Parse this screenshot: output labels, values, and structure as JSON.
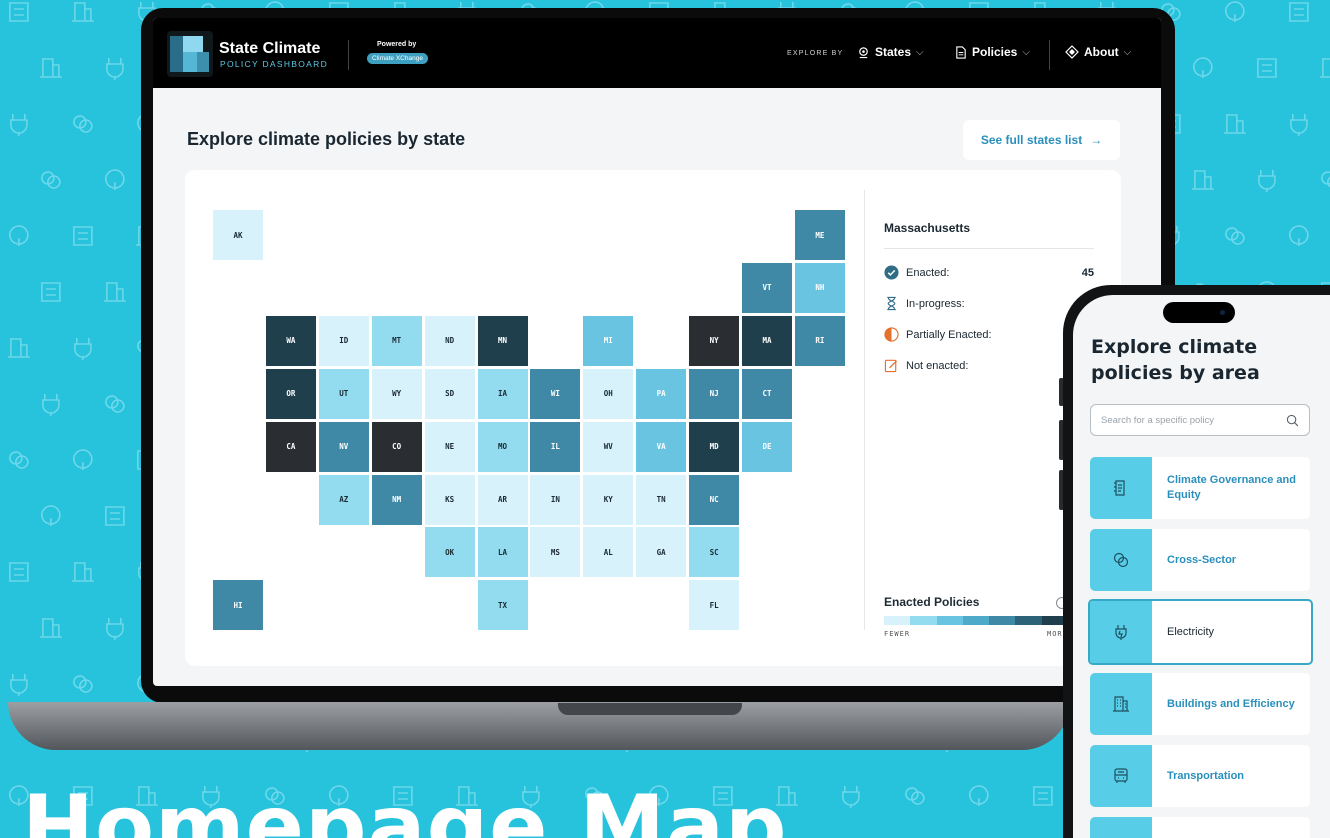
{
  "app": {
    "logo_title": "State Climate",
    "logo_subtitle": "POLICY DASHBOARD",
    "powered_by": "Powered by",
    "partner": "Climate XChange"
  },
  "nav": {
    "explore_by": "EXPLORE BY",
    "states": "States",
    "policies": "Policies",
    "about": "About"
  },
  "page": {
    "title": "Explore climate policies by state",
    "see_all": "See full states list",
    "see_all_arrow": "→"
  },
  "map": {
    "states": [
      {
        "abbr": "AK",
        "shade": 1
      },
      {
        "abbr": "ME",
        "shade": 4
      },
      {
        "abbr": "VT",
        "shade": 4
      },
      {
        "abbr": "NH",
        "shade": 3
      },
      {
        "abbr": "WA",
        "shade": 5
      },
      {
        "abbr": "ID",
        "shade": 1
      },
      {
        "abbr": "MT",
        "shade": 2
      },
      {
        "abbr": "ND",
        "shade": 1
      },
      {
        "abbr": "MN",
        "shade": 5
      },
      {
        "abbr": "MI",
        "shade": 3
      },
      {
        "abbr": "NY",
        "shade": 6
      },
      {
        "abbr": "MA",
        "shade": 5
      },
      {
        "abbr": "RI",
        "shade": 4
      },
      {
        "abbr": "OR",
        "shade": 5
      },
      {
        "abbr": "UT",
        "shade": 2
      },
      {
        "abbr": "WY",
        "shade": 1
      },
      {
        "abbr": "SD",
        "shade": 1
      },
      {
        "abbr": "IA",
        "shade": 2
      },
      {
        "abbr": "WI",
        "shade": 4
      },
      {
        "abbr": "OH",
        "shade": 1
      },
      {
        "abbr": "PA",
        "shade": 3
      },
      {
        "abbr": "NJ",
        "shade": 4
      },
      {
        "abbr": "CT",
        "shade": 4
      },
      {
        "abbr": "CA",
        "shade": 6
      },
      {
        "abbr": "NV",
        "shade": 4
      },
      {
        "abbr": "CO",
        "shade": 6
      },
      {
        "abbr": "NE",
        "shade": 1
      },
      {
        "abbr": "MO",
        "shade": 2
      },
      {
        "abbr": "IL",
        "shade": 4
      },
      {
        "abbr": "WV",
        "shade": 1
      },
      {
        "abbr": "VA",
        "shade": 3
      },
      {
        "abbr": "MD",
        "shade": 5
      },
      {
        "abbr": "DE",
        "shade": 3
      },
      {
        "abbr": "AZ",
        "shade": 2
      },
      {
        "abbr": "NM",
        "shade": 4
      },
      {
        "abbr": "KS",
        "shade": 1
      },
      {
        "abbr": "AR",
        "shade": 1
      },
      {
        "abbr": "IN",
        "shade": 1
      },
      {
        "abbr": "KY",
        "shade": 1
      },
      {
        "abbr": "TN",
        "shade": 1
      },
      {
        "abbr": "NC",
        "shade": 4
      },
      {
        "abbr": "OK",
        "shade": 2
      },
      {
        "abbr": "LA",
        "shade": 2
      },
      {
        "abbr": "MS",
        "shade": 1
      },
      {
        "abbr": "AL",
        "shade": 1
      },
      {
        "abbr": "GA",
        "shade": 1
      },
      {
        "abbr": "SC",
        "shade": 2
      },
      {
        "abbr": "HI",
        "shade": 4
      },
      {
        "abbr": "TX",
        "shade": 2
      },
      {
        "abbr": "FL",
        "shade": 1
      }
    ]
  },
  "panel": {
    "state": "Massachusetts",
    "enacted_label": "Enacted:",
    "enacted_count": "45",
    "in_progress_label": "In-progress:",
    "partial_label": "Partially Enacted:",
    "not_enacted_label": "Not enacted:"
  },
  "legend": {
    "title": "Enacted Policies",
    "fewer": "FEWER",
    "more": "MORE",
    "colors": [
      "#d8f2fb",
      "#93dcf0",
      "#68c4e1",
      "#4fa9c8",
      "#3f89a6",
      "#2d6379",
      "#1f3f4d",
      "#2a2d31"
    ]
  },
  "phone": {
    "title": "Explore climate policies by area",
    "search_placeholder": "Search for a specific policy",
    "areas": [
      {
        "label": "Climate Governance and Equity",
        "icon": "document-icon"
      },
      {
        "label": "Cross-Sector",
        "icon": "overlap-circles-icon"
      },
      {
        "label": "Electricity",
        "icon": "plug-icon"
      },
      {
        "label": "Buildings and Efficiency",
        "icon": "building-icon"
      },
      {
        "label": "Transportation",
        "icon": "bus-icon"
      }
    ],
    "active_area": "Electricity"
  },
  "colors": {
    "background": "#27c2dc",
    "accent": "#2a8fbc",
    "shades": [
      "#d8f2fb",
      "#93dcf0",
      "#68c4e1",
      "#3f89a6",
      "#1f3f4d",
      "#2a2d31"
    ]
  },
  "caption": "Homepage Map"
}
